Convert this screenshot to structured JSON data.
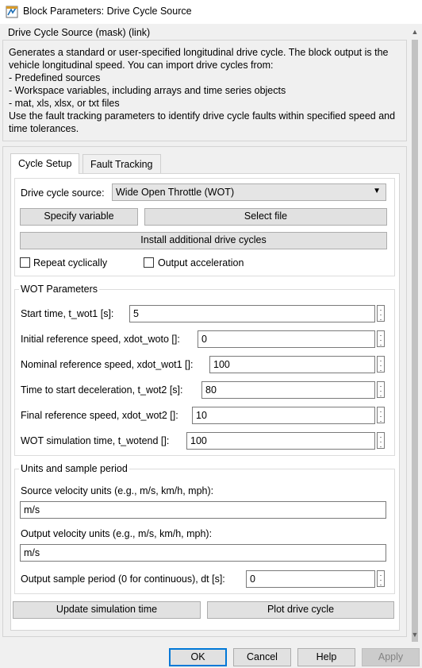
{
  "window": {
    "title": "Block Parameters: Drive Cycle Source"
  },
  "mask_header": "Drive Cycle Source (mask) (link)",
  "description": "Generates a standard or user-specified longitudinal drive cycle. The block output is the vehicle longitudinal speed. You can import drive cycles from:\n- Predefined sources\n- Workspace variables, including arrays and time series objects\n- mat, xls, xlsx, or txt files\nUse the fault tracking parameters to identify drive cycle faults within specified speed and time tolerances.",
  "tabs": [
    {
      "label": "Cycle Setup",
      "active": true
    },
    {
      "label": "Fault Tracking",
      "active": false
    }
  ],
  "cycle_setup": {
    "source_label": "Drive cycle source:",
    "source_value": "Wide Open Throttle (WOT)",
    "specify_variable": "Specify variable",
    "select_file": "Select file",
    "install_cycles": "Install additional drive cycles",
    "repeat_cyclically": {
      "label": "Repeat cyclically",
      "checked": false
    },
    "output_acceleration": {
      "label": "Output acceleration",
      "checked": false
    }
  },
  "wot": {
    "group_label": "WOT Parameters",
    "params": [
      {
        "label": "Start time, t_wot1 [s]:",
        "value": "5"
      },
      {
        "label": "Initial reference speed, xdot_woto []:",
        "value": "0"
      },
      {
        "label": "Nominal reference speed, xdot_wot1 []:",
        "value": "100"
      },
      {
        "label": "Time to start deceleration, t_wot2 [s]:",
        "value": "80"
      },
      {
        "label": "Final reference speed, xdot_wot2 []:",
        "value": "10"
      },
      {
        "label": "WOT simulation time, t_wotend []:",
        "value": "100"
      }
    ]
  },
  "units": {
    "group_label": "Units and sample period",
    "source_units_label": "Source velocity units (e.g., m/s, km/h, mph):",
    "source_units_value": "m/s",
    "output_units_label": "Output velocity units (e.g., m/s, km/h, mph):",
    "output_units_value": "m/s",
    "sample_period_label": "Output sample period (0 for continuous), dt [s]:",
    "sample_period_value": "0"
  },
  "actions": {
    "update_sim_time": "Update simulation time",
    "plot_cycle": "Plot drive cycle"
  },
  "dialog_buttons": {
    "ok": "OK",
    "cancel": "Cancel",
    "help": "Help",
    "apply": "Apply"
  },
  "colors": {
    "ok_border": "#0078d7",
    "dialog_bg": "#f0f0f0"
  },
  "icons": {
    "app": "simulink-block-icon",
    "dots": "vertical-ellipsis-icon",
    "caret": "dropdown-caret-icon",
    "scroll_up": "scroll-up-arrow-icon",
    "scroll_down": "scroll-down-arrow-icon"
  }
}
